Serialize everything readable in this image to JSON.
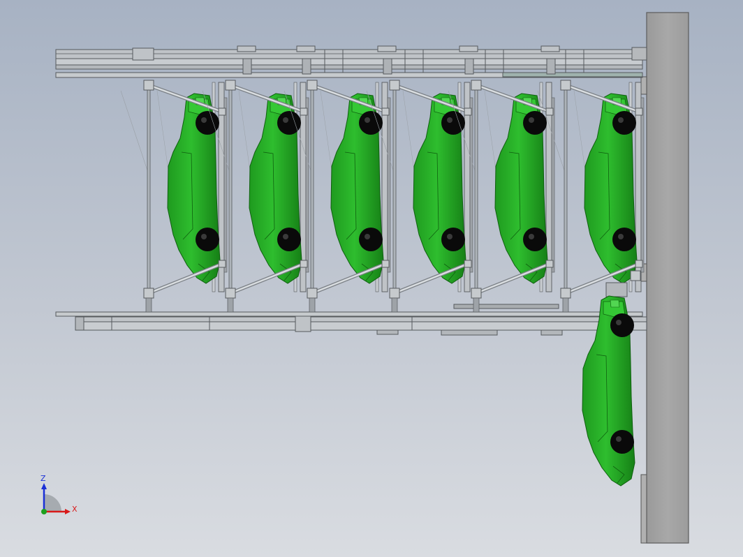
{
  "view": {
    "background_top": "#a7b2c3",
    "background_bottom": "#d9dce1"
  },
  "model": {
    "car_color": "#22a822",
    "car_outline": "#0f5f0f",
    "frame_color": "#bfc3c7",
    "frame_outline": "#55595d",
    "wall_color": "#a3a3a3",
    "wheel_color": "#0a0a0a",
    "stored_cars": 6,
    "hanging_cars": 1
  },
  "triad": {
    "z_label": "Z",
    "x_label": "X",
    "z_color": "#1a2fd6",
    "x_color": "#d81a1a",
    "y_color": "#1ea01e"
  }
}
